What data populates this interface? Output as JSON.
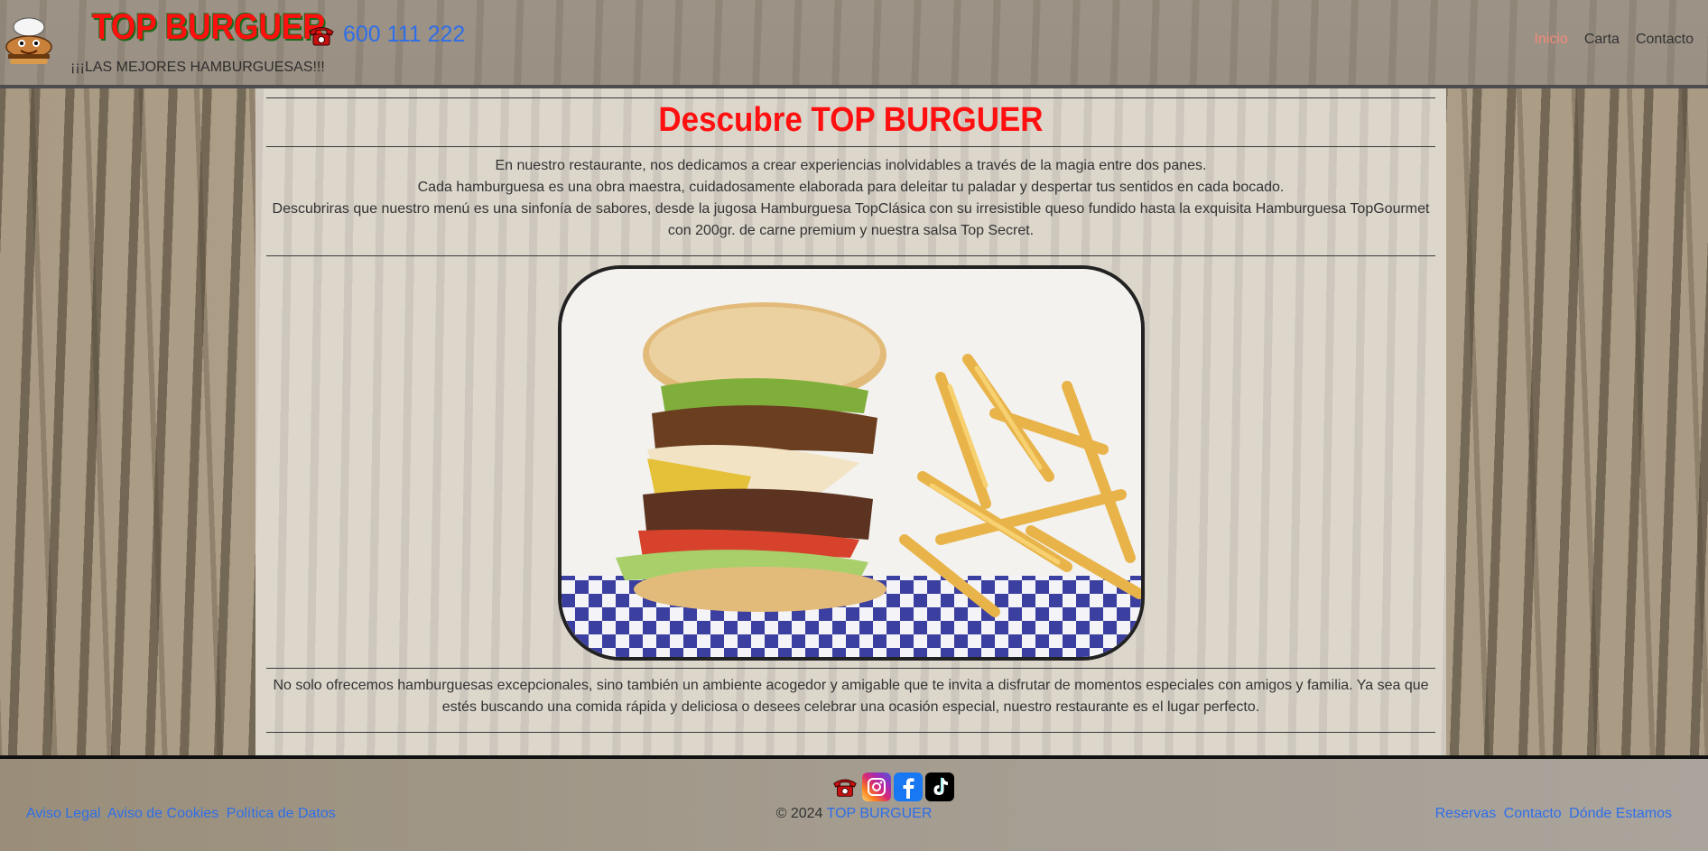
{
  "header": {
    "brand": "TOP BURGUER",
    "phone": "600 111 222",
    "tagline": "¡¡¡LAS MEJORES HAMBURGUESAS!!!",
    "nav": [
      {
        "label": "Inicio"
      },
      {
        "label": "Carta"
      },
      {
        "label": "Contacto"
      }
    ]
  },
  "main": {
    "title": "Descubre TOP BURGUER",
    "intro_lines": [
      "En nuestro restaurante, nos dedicamos a crear experiencias inolvidables a través de la magia entre dos panes.",
      "Cada hamburguesa es una obra maestra, cuidadosamente elaborada para deleitar tu paladar y despertar tus sentidos en cada bocado.",
      "Descubriras que nuestro menú es una sinfonía de sabores, desde la jugosa Hamburguesa TopClásica con su irresistible queso fundido hasta la exquisita Hamburguesa TopGourmet con 200gr. de carne premium y nuestra salsa Top Secret."
    ],
    "outro": "No solo ofrecemos hamburguesas excepcionales, sino también un ambiente acogedor y amigable que te invita a disfrutar de momentos especiales con amigos y familia. Ya sea que estés buscando una comida rápida y deliciosa o desees celebrar una ocasión especial, nuestro restaurante es el lugar perfecto."
  },
  "footer": {
    "left_links": [
      "Aviso Legal",
      "Aviso de Cookies",
      "Política de Datos"
    ],
    "copyright_prefix": "© 2024",
    "copyright_brand": "TOP BURGUER",
    "right_links": [
      "Reservas",
      "Contacto",
      "Dónde Estamos"
    ],
    "social_icons": [
      "phone-icon",
      "instagram-icon",
      "facebook-icon",
      "tiktok-icon"
    ]
  },
  "colors": {
    "brand_red": "#ff1010",
    "link_blue": "#2f6ee8",
    "nav_active": "#f28b7a"
  }
}
